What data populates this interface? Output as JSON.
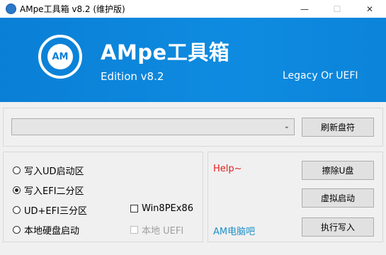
{
  "window": {
    "title": "AMpe工具箱 v8.2 (维护版)",
    "minimize": "—",
    "maximize": "☐",
    "close": "✕"
  },
  "banner": {
    "logo_text": "AM",
    "title": "AMpe工具箱",
    "edition": "Edition  v8.2",
    "mode": "Legacy Or UEFI"
  },
  "drive": {
    "selected": "",
    "refresh_label": "刷新盘符"
  },
  "options": {
    "items": [
      {
        "label": "写入UD启动区",
        "checked": false
      },
      {
        "label": "写入EFI二分区",
        "checked": true
      },
      {
        "label": "UD+EFI三分区",
        "checked": false
      },
      {
        "label": "本地硬盘启动",
        "checked": false
      }
    ],
    "win8pe_label": "Win8PEx86",
    "local_uefi_label": "本地 UEFI"
  },
  "actions": {
    "help": "Help~",
    "brand": "AM电脑吧",
    "erase_label": "擦除U盘",
    "virtual_boot_label": "虚拟启动",
    "execute_label": "执行写入"
  },
  "colors": {
    "banner": "#0a7fd6",
    "help": "#e02020",
    "brand": "#1e90c8"
  }
}
